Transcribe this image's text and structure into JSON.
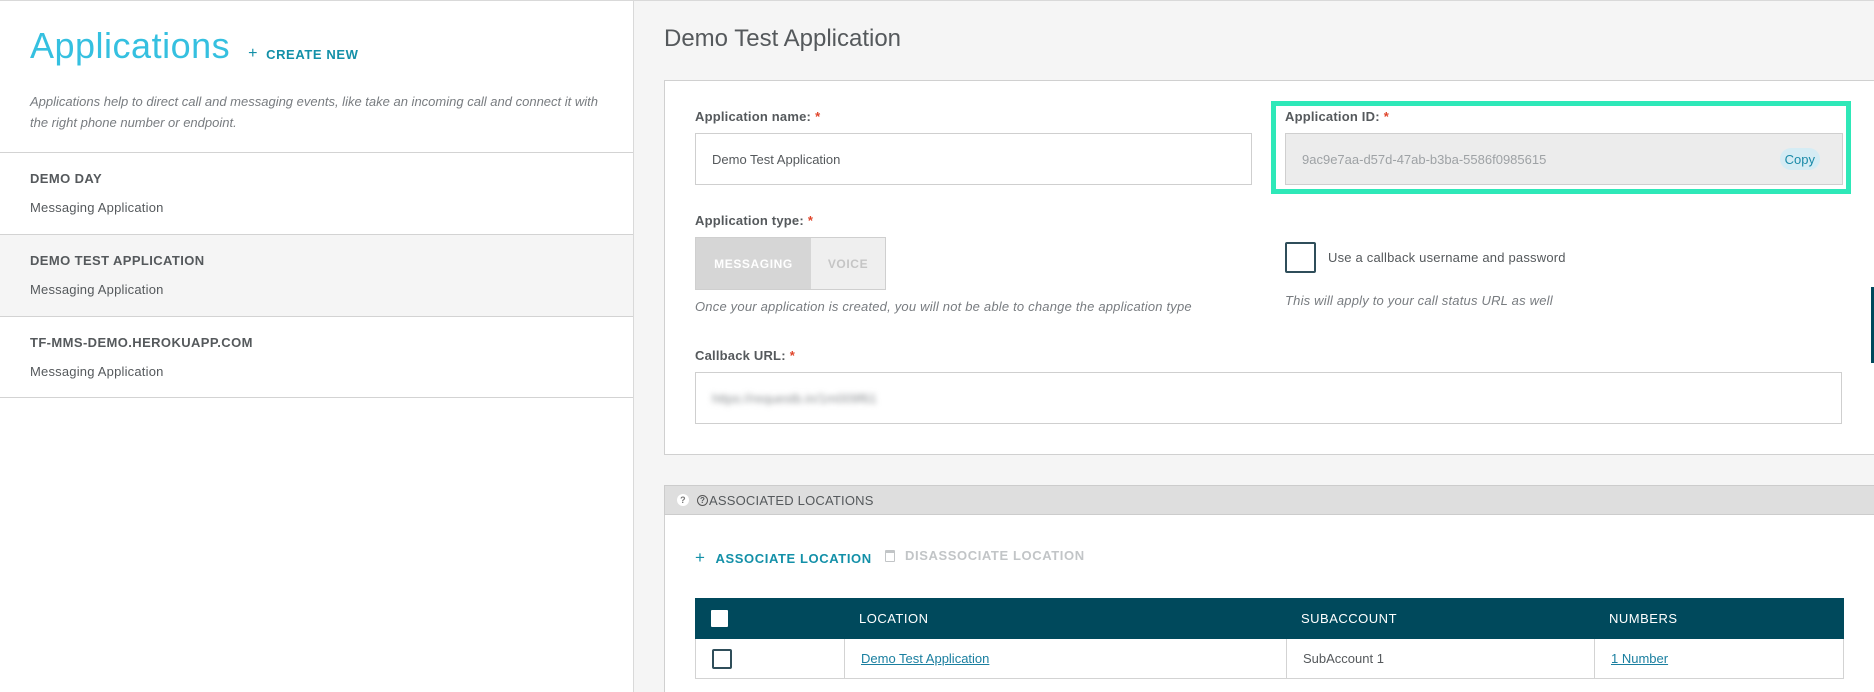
{
  "sidebar": {
    "title": "Applications",
    "create_new_label": "CREATE NEW",
    "description": "Applications help to direct call and messaging events, like take an incoming call and connect it with the right phone number or endpoint.",
    "items": [
      {
        "name": "DEMO DAY",
        "type": "Messaging Application"
      },
      {
        "name": "DEMO TEST APPLICATION",
        "type": "Messaging Application"
      },
      {
        "name": "TF-MMS-DEMO.HEROKUAPP.COM",
        "type": "Messaging Application"
      }
    ]
  },
  "main": {
    "title": "Demo Test Application",
    "form": {
      "app_name_label": "Application name:",
      "app_name_value": "Demo Test Application",
      "app_id_label": "Application ID:",
      "app_id_value": "9ac9e7aa-d57d-47ab-b3ba-5586f0985615",
      "copy_label": "Copy",
      "app_type_label": "Application type:",
      "type_messaging": "MESSAGING",
      "type_voice": "VOICE",
      "type_hint": "Once your application is created, you will not be able to change the application type",
      "callback_checkbox_label": "Use a callback username and password",
      "callback_checkbox_hint": "This will apply to your call status URL as well",
      "callback_url_label": "Callback URL:",
      "callback_url_value": "https://requestb.in/1m009f61",
      "required_mark": "*"
    },
    "associated": {
      "section_title": "ASSOCIATED LOCATIONS",
      "associate_label": "ASSOCIATE LOCATION",
      "disassociate_label": "DISASSOCIATE LOCATION",
      "columns": [
        "LOCATION",
        "SUBACCOUNT",
        "NUMBERS"
      ],
      "rows": [
        {
          "location": "Demo Test Application",
          "subaccount": "SubAccount 1",
          "numbers": "1 Number"
        }
      ]
    }
  },
  "colors": {
    "accent": "#35c0e0",
    "link": "#1390a8",
    "table_header": "#00495c",
    "highlight": "#2ee8b8",
    "required": "#e0442a"
  }
}
